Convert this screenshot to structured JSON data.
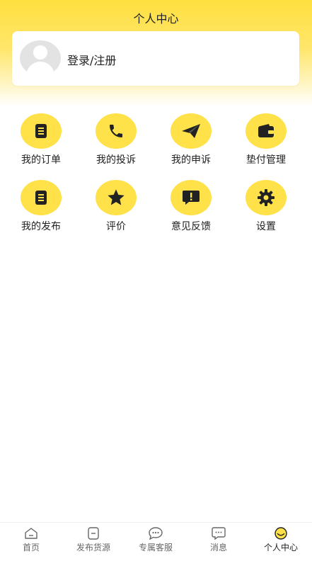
{
  "header": {
    "title": "个人中心"
  },
  "login": {
    "label": "登录/注册"
  },
  "colors": {
    "accent": "#ffe14a",
    "icon": "#222222"
  },
  "menu": [
    {
      "label": "我的订单",
      "icon": "order-list-icon"
    },
    {
      "label": "我的投诉",
      "icon": "phone-icon"
    },
    {
      "label": "我的申诉",
      "icon": "paper-plane-icon"
    },
    {
      "label": "垫付管理",
      "icon": "wallet-icon"
    },
    {
      "label": "我的发布",
      "icon": "document-list-icon"
    },
    {
      "label": "评价",
      "icon": "star-icon"
    },
    {
      "label": "意见反馈",
      "icon": "feedback-icon"
    },
    {
      "label": "设置",
      "icon": "gear-icon"
    }
  ],
  "tabs": [
    {
      "label": "首页",
      "icon": "home-icon"
    },
    {
      "label": "发布货源",
      "icon": "publish-icon"
    },
    {
      "label": "专属客服",
      "icon": "service-chat-icon"
    },
    {
      "label": "消息",
      "icon": "message-icon"
    },
    {
      "label": "个人中心",
      "icon": "profile-icon",
      "active": true
    }
  ]
}
